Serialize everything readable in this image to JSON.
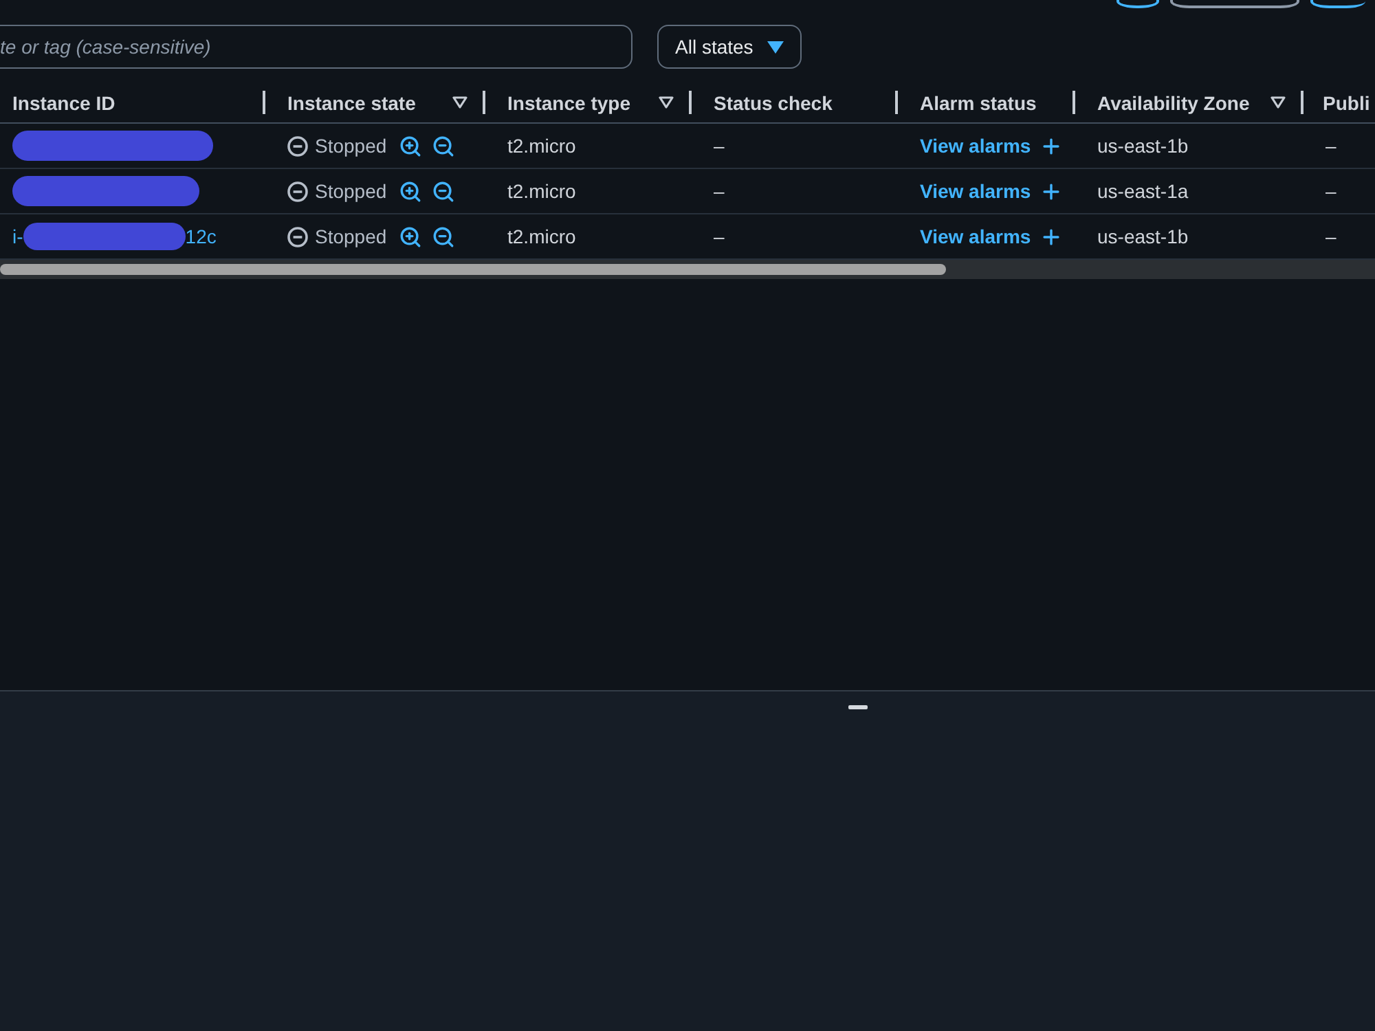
{
  "toolbar": {
    "search": {
      "placeholder": "te or tag (case-sensitive)"
    },
    "state_filter": {
      "label": "All states"
    }
  },
  "table": {
    "columns": [
      {
        "label": "Instance ID",
        "filter": false
      },
      {
        "label": "Instance state",
        "filter": true
      },
      {
        "label": "Instance type",
        "filter": true
      },
      {
        "label": "Status check",
        "filter": false
      },
      {
        "label": "Alarm status",
        "filter": false
      },
      {
        "label": "Availability Zone",
        "filter": true
      },
      {
        "label": "Publi",
        "filter": false
      }
    ],
    "rows": [
      {
        "redacted": true,
        "state": {
          "label": "Stopped",
          "kind": "stopped"
        },
        "type": "t2.micro",
        "status_check": "–",
        "alarm": "View alarms",
        "zone": "us-east-1b",
        "public": "–"
      },
      {
        "redacted": true,
        "state": {
          "label": "Stopped",
          "kind": "stopped"
        },
        "type": "t2.micro",
        "status_check": "–",
        "alarm": "View alarms",
        "zone": "us-east-1a",
        "public": "–"
      },
      {
        "redacted": true,
        "id_start": "i-",
        "id_end": "12c",
        "state": {
          "label": "Stopped",
          "kind": "stopped"
        },
        "type": "t2.micro",
        "status_check": "–",
        "alarm": "View alarms",
        "zone": "us-east-1b",
        "public": "–"
      }
    ]
  }
}
